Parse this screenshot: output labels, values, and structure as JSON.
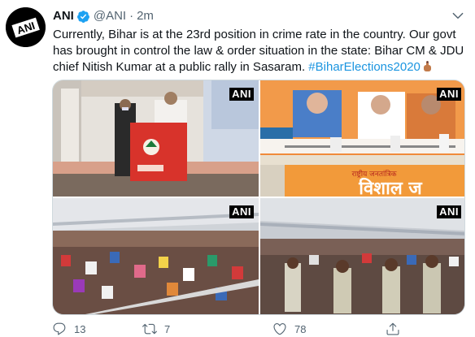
{
  "tweet": {
    "author_name": "ANI",
    "handle": "@ANI",
    "separator": "·",
    "time": "2m",
    "avatar_text": "ANI",
    "text_lines": [
      "Currently, Bihar is at the 23rd position in crime rate in the country. Our govt",
      "has brought in control the law & order situation in the state: Bihar CM & JDU",
      "chief Nitish Kumar at a public rally in Sasaram."
    ],
    "hashtag": "#BiharElections2020",
    "media_watermark": "ANI",
    "banner_text": "विशाल ज",
    "banner_small_text": "राष्ट्रीय जनतांत्रिक",
    "counts": {
      "replies": "13",
      "retweets": "7",
      "likes": "78"
    },
    "icons": {
      "verified": "verified-badge-icon",
      "reply": "reply-icon",
      "retweet": "retweet-icon",
      "like": "heart-icon",
      "share": "share-icon",
      "more": "chevron-down-icon"
    },
    "colors": {
      "link": "#1b95e0",
      "verified": "#1da1f2",
      "muted": "#536471"
    }
  }
}
